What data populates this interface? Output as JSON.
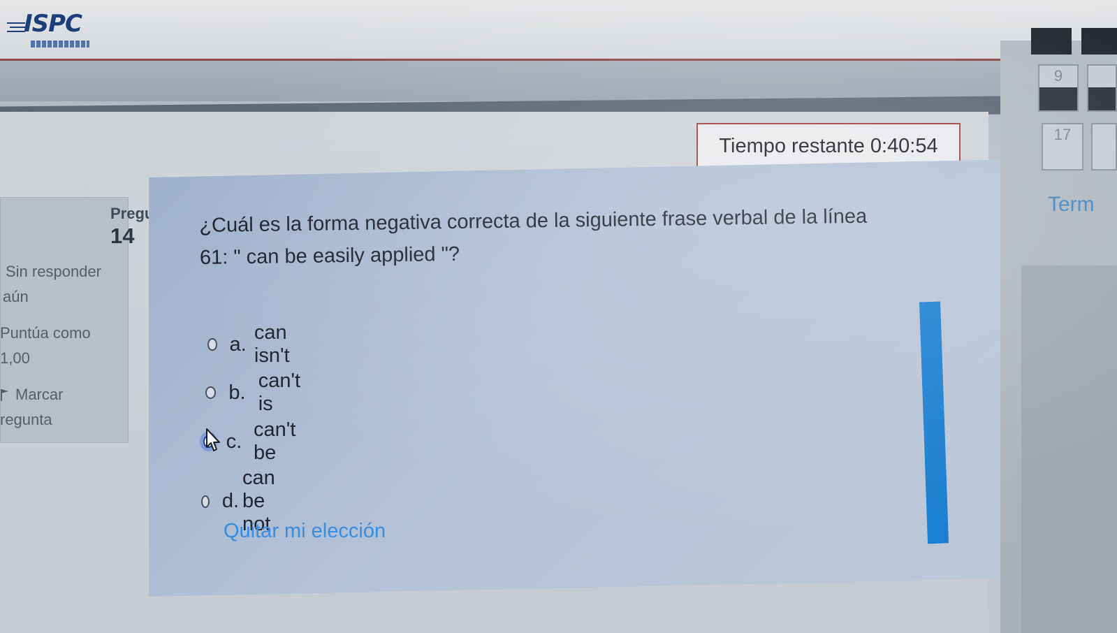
{
  "header": {
    "logo_text": "ISPC"
  },
  "timer": {
    "label": "Tiempo restante",
    "value": "0:40:54"
  },
  "question_info": {
    "label": "Pregun",
    "number": "14",
    "status_line1": "Sin responder",
    "status_line2": "aún",
    "points_line1": "Puntúa como",
    "points_line2": "1,00",
    "flag_line1": "Marcar",
    "flag_line2": "regunta"
  },
  "question": {
    "text_line1": "¿Cuál es la forma negativa correcta de la siguiente frase verbal de la línea",
    "text_line2": "61: \" can be easily applied \"?"
  },
  "answers": [
    {
      "letter": "a.",
      "text": "can isn't",
      "selected": false
    },
    {
      "letter": "b.",
      "text": "can't is",
      "selected": false
    },
    {
      "letter": "c.",
      "text": "can't be",
      "selected": true
    },
    {
      "letter": "d.",
      "text": "can be not",
      "selected": false
    }
  ],
  "clear_choice_label": "Quitar mi elección",
  "quiz_nav": {
    "buttons": [
      {
        "number": "",
        "answered": true
      },
      {
        "number": "9",
        "answered": true
      },
      {
        "number": "17",
        "answered": false
      }
    ],
    "finish_label": "Term"
  },
  "colors": {
    "timer_border": "#a0413a",
    "link": "#3a8ee0",
    "scrollbar": "#1a7fd0",
    "selected_radio": "#1d3f9e"
  }
}
